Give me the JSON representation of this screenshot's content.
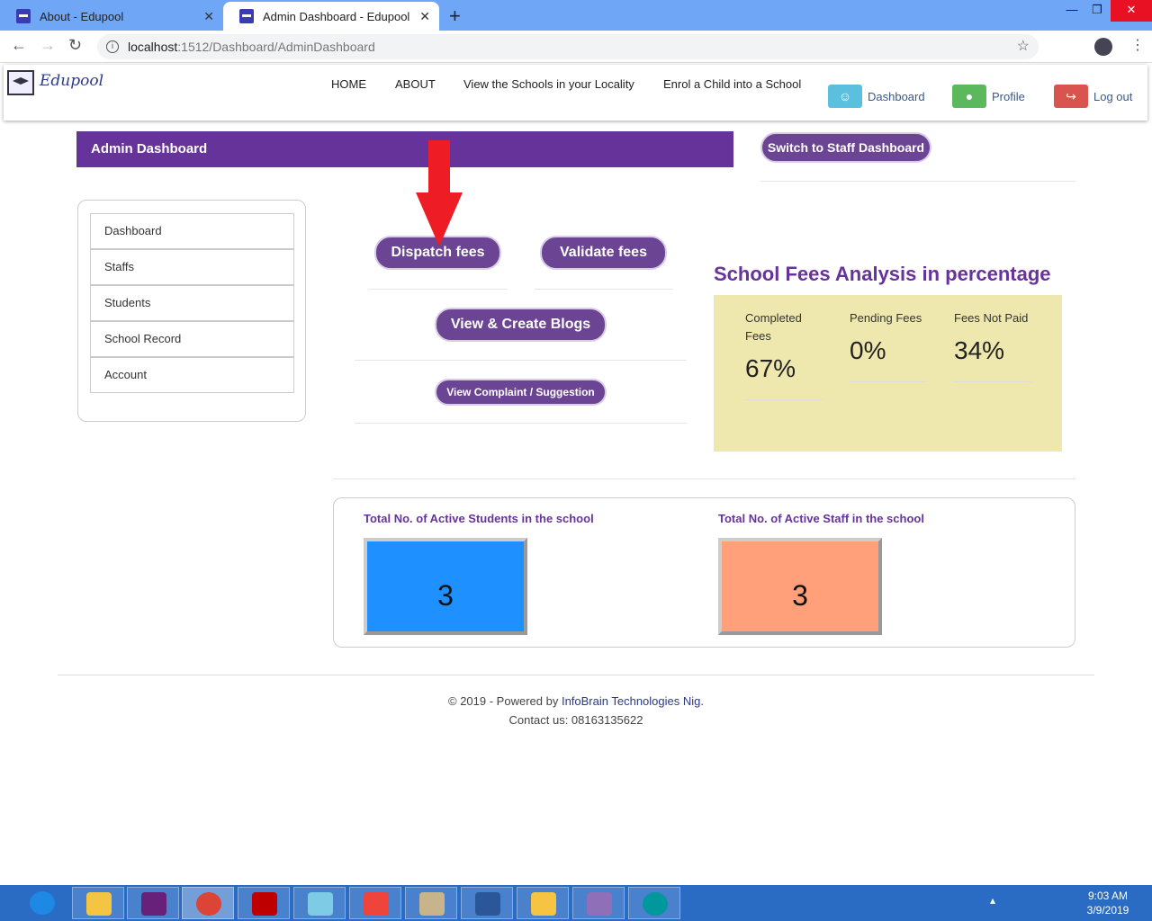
{
  "browser": {
    "tabs": [
      {
        "title": "About - Edupool",
        "close": "✕"
      },
      {
        "title": "Admin Dashboard - Edupool",
        "close": "✕"
      }
    ],
    "new_tab": "+",
    "window_controls": {
      "minimize": "—",
      "maximize": "❐",
      "close": "✕"
    },
    "nav": {
      "back": "←",
      "forward": "→",
      "reload": "↻"
    },
    "url_host": "localhost",
    "url_rest": ":1512/Dashboard/AdminDashboard",
    "bookmark_star": "☆",
    "menu": "⋮"
  },
  "header": {
    "logo": "Edupool",
    "nav": [
      "HOME",
      "ABOUT",
      "View the Schools in your Locality",
      "Enrol a Child into a School"
    ],
    "dashboard": "Dashboard",
    "profile": "Profile",
    "logout": "Log out",
    "colors": {
      "dashboard": "#5bc0de",
      "profile": "#5cb85c",
      "logout": "#d9534f"
    }
  },
  "main": {
    "title": "Admin Dashboard",
    "switch_button": "Switch to Staff Dashboard",
    "sidebar": [
      "Dashboard",
      "Staffs",
      "Students",
      "School Record",
      "Account"
    ],
    "buttons": {
      "dispatch": "Dispatch fees",
      "validate": "Validate fees",
      "blogs": "View & Create Blogs",
      "complaint": "View Complaint / Suggestion"
    },
    "fees": {
      "title": "School Fees Analysis in percentage",
      "completed_label": "Completed Fees",
      "completed_value": "67%",
      "pending_label": "Pending Fees",
      "pending_value": "0%",
      "not_paid_label": "Fees Not Paid",
      "not_paid_value": "34%"
    },
    "counts": {
      "students_label": "Total No. of Active Students in the school",
      "students_value": "3",
      "staff_label": "Total No. of Active Staff in the school",
      "staff_value": "3",
      "colors": {
        "students": "#1e90ff",
        "staff": "#ffa07a"
      }
    },
    "accent": "#66339a"
  },
  "footer": {
    "prefix": "© 2019 - Powered by ",
    "company": "InfoBrain Technologies Nig.",
    "contact": "Contact us: 08163135622"
  },
  "taskbar": {
    "tray": "▴",
    "time": "9:03 AM",
    "date": "3/9/2019"
  }
}
